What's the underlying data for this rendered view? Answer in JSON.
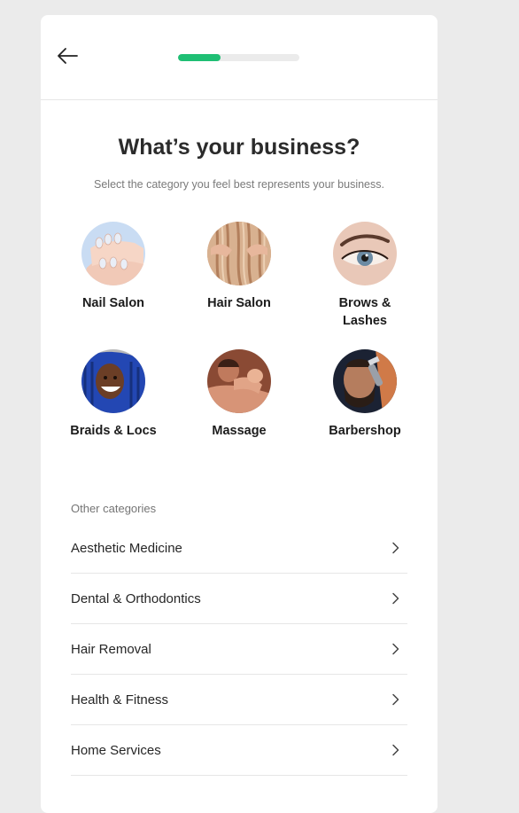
{
  "header": {
    "back_icon": "arrow-left-icon",
    "progress_fraction": 0.35,
    "progress_color": "#1fbf74"
  },
  "main": {
    "title": "What’s your business?",
    "subtitle": "Select the category you feel best represents your business."
  },
  "categories": [
    {
      "label": "Nail Salon",
      "image": "nail-salon-photo"
    },
    {
      "label": "Hair Salon",
      "image": "hair-salon-photo"
    },
    {
      "label": "Brows & Lashes",
      "image": "brows-lashes-photo"
    },
    {
      "label": "Braids & Locs",
      "image": "braids-locs-photo"
    },
    {
      "label": "Massage",
      "image": "massage-photo"
    },
    {
      "label": "Barbershop",
      "image": "barbershop-photo"
    }
  ],
  "other_categories": {
    "heading": "Other categories",
    "items": [
      {
        "label": "Aesthetic Medicine"
      },
      {
        "label": "Dental & Orthodontics"
      },
      {
        "label": "Hair Removal"
      },
      {
        "label": "Health & Fitness"
      },
      {
        "label": "Home Services"
      }
    ]
  },
  "colors": {
    "background": "#ebebeb",
    "card": "#ffffff",
    "accent": "#1fbf74",
    "divider": "#e6e6e6"
  }
}
